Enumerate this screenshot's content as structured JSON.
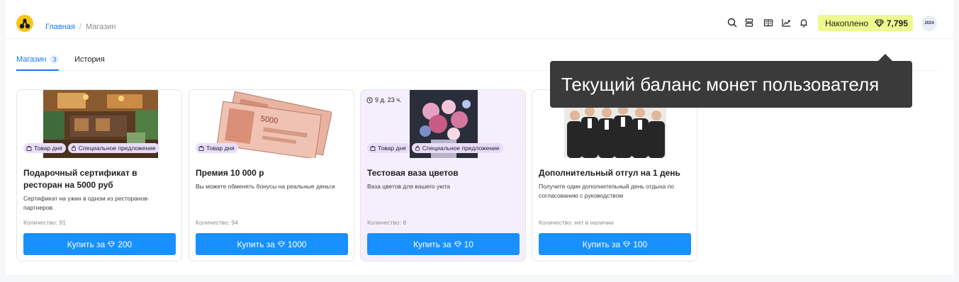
{
  "breadcrumb": {
    "home": "Главная",
    "separator": "/",
    "current": "Магазин"
  },
  "header": {
    "icons": [
      "search-icon",
      "layers-icon",
      "book-icon",
      "chart-icon",
      "bell-icon"
    ],
    "balance_label": "Накоплено",
    "balance_amount": "7,795",
    "avatar_text": "2024",
    "accent_color": "#eef98f"
  },
  "tabs": [
    {
      "label": "Магазин",
      "count": "3"
    },
    {
      "label": "История"
    }
  ],
  "tooltip": {
    "text": "Текущий баланс монет пользователя"
  },
  "cards": [
    {
      "badges": [
        "Товар дня",
        "Специальное предложение"
      ],
      "title": "Подарочный сертификат в ресторан на 5000 руб",
      "description": "Сертификат на ужин в одном из ресторанов-партнеров",
      "quantity": "Количество: 91",
      "buy_label": "Купить за",
      "price": "200"
    },
    {
      "badges": [
        "Товар дня"
      ],
      "title": "Премия 10 000 р",
      "description": "Вы можете обменять бонусы на реальные деньги",
      "quantity": "Количество: 94",
      "buy_label": "Купить за",
      "price": "1000"
    },
    {
      "timer": "9 д. 23 ч.",
      "badges": [
        "Товар дня",
        "Специальное предложение"
      ],
      "title": "Тестовая ваза цветов",
      "description": "Ваза цветов для вашего уюта",
      "quantity": "Количество: 8",
      "buy_label": "Купить за",
      "price": "10"
    },
    {
      "badges": [],
      "title": "Дополнительный отгул на 1 день",
      "description": "Получите один дополнительный день отдыха по согласованию с руководством",
      "quantity": "Количество: нет в наличии",
      "buy_label": "Купить за",
      "price": "100"
    }
  ],
  "colors": {
    "primary": "#1890ff",
    "badge_bg": "#e9dcfb",
    "highlight_card": "#f5effd"
  }
}
